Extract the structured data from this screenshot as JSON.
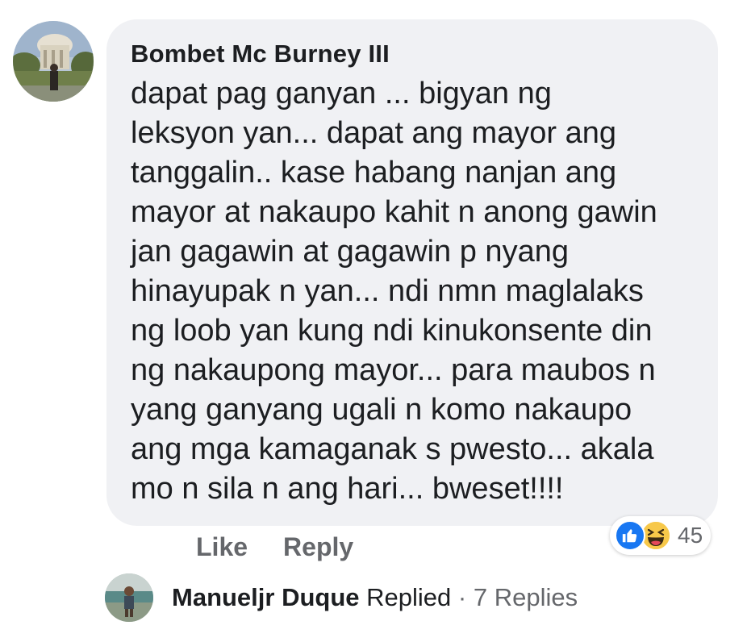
{
  "comment": {
    "author": "Bombet Mc Burney III",
    "lines": [
      "dapat pag ganyan ...  bigyan ng",
      "leksyon yan... dapat ang mayor ang",
      "tanggalin.. kase habang nanjan ang",
      "mayor at nakaupo kahit n anong gawin",
      "jan gagawin at gagawin p nyang",
      "hinayupak n yan... ndi nmn maglalaks",
      "ng loob yan kung ndi kinukonsente din",
      "ng nakaupong mayor... para maubos n",
      "yang ganyang ugali n komo nakaupo",
      "ang mga kamaganak s pwesto... akala",
      "mo n sila n ang hari... bweset!!!!"
    ]
  },
  "actions": {
    "like_label": "Like",
    "reply_label": "Reply"
  },
  "reactions": {
    "types": [
      "like-icon",
      "haha-icon"
    ],
    "count": "45",
    "colors": {
      "like": "#1877f2",
      "haha": "#f7c84a"
    }
  },
  "replies_summary": {
    "name": "Manueljr Duque",
    "action": "Replied",
    "separator": "·",
    "count_text": "7 Replies"
  },
  "colors": {
    "bubble": "#f0f1f4",
    "text": "#1c1e21",
    "muted": "#65676b"
  }
}
